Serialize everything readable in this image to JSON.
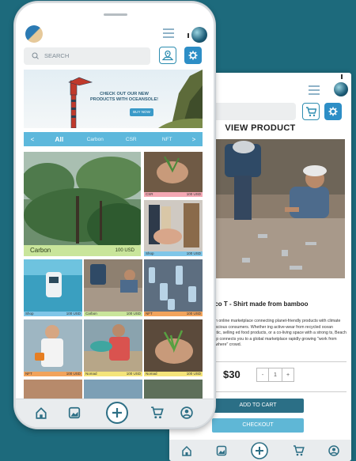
{
  "front": {
    "search_placeholder": "SEARCH",
    "banner": {
      "headline": "CHECK OUT OUR NEW PRODUCTS WITH OCEANSOLE!",
      "button": "BUY NOW"
    },
    "tabs": {
      "prev": "<",
      "items": [
        "All",
        "Carbon",
        "CSR",
        "NFT"
      ],
      "next": ">"
    },
    "featured": {
      "category": "Carbon",
      "price": "100 USD"
    },
    "tiles": [
      {
        "category": "CSR",
        "price": "100 USD",
        "color": "#f4a7b3"
      },
      {
        "category": "Shop",
        "price": "100 USD",
        "color": "#7fc6e8"
      },
      {
        "category": "Shop",
        "price": "100 USD",
        "color": "#7fc6e8"
      },
      {
        "category": "Carbon",
        "price": "100 USD",
        "color": "#c9e59b"
      },
      {
        "category": "NFT",
        "price": "100 USD",
        "color": "#f1a35c"
      },
      {
        "category": "NFT",
        "price": "100 USD",
        "color": "#f1a35c"
      },
      {
        "category": "Nomad",
        "price": "100 USD",
        "color": "#f4e47a"
      },
      {
        "category": "Nomad",
        "price": "100 USD",
        "color": "#f4e47a"
      }
    ]
  },
  "back": {
    "search_placeholder": "SEARCH",
    "title": "VIEW PRODUCT",
    "product_name": "Eco T - Shirt made from bamboo",
    "description": "is an online marketplace connecting planet-friendly products with climate conscious consumers. Whether ing active-wear from recycled ocean plastic, selling ed food products, or a co-living space with a strong ts, Beach Shop connects you to a global marketplace rapidly growing \"work from anywhere\" crowd.",
    "price": "$30",
    "quantity": {
      "minus": "-",
      "value": "1",
      "plus": "+"
    },
    "add_to_cart": "ADD TO CART",
    "checkout": "CHECKOUT"
  },
  "colors": {
    "background": "#1d6a7c",
    "accent": "#2d8ec6",
    "tab_bar": "#5db8dc",
    "add_to_cart": "#2b6f86",
    "checkout": "#5fb7d6"
  },
  "icons": [
    "search-icon",
    "map-icon",
    "gear-icon",
    "cart-icon",
    "home-icon",
    "gallery-icon",
    "plus-icon",
    "user-icon",
    "menu-icon",
    "globe-icon"
  ]
}
